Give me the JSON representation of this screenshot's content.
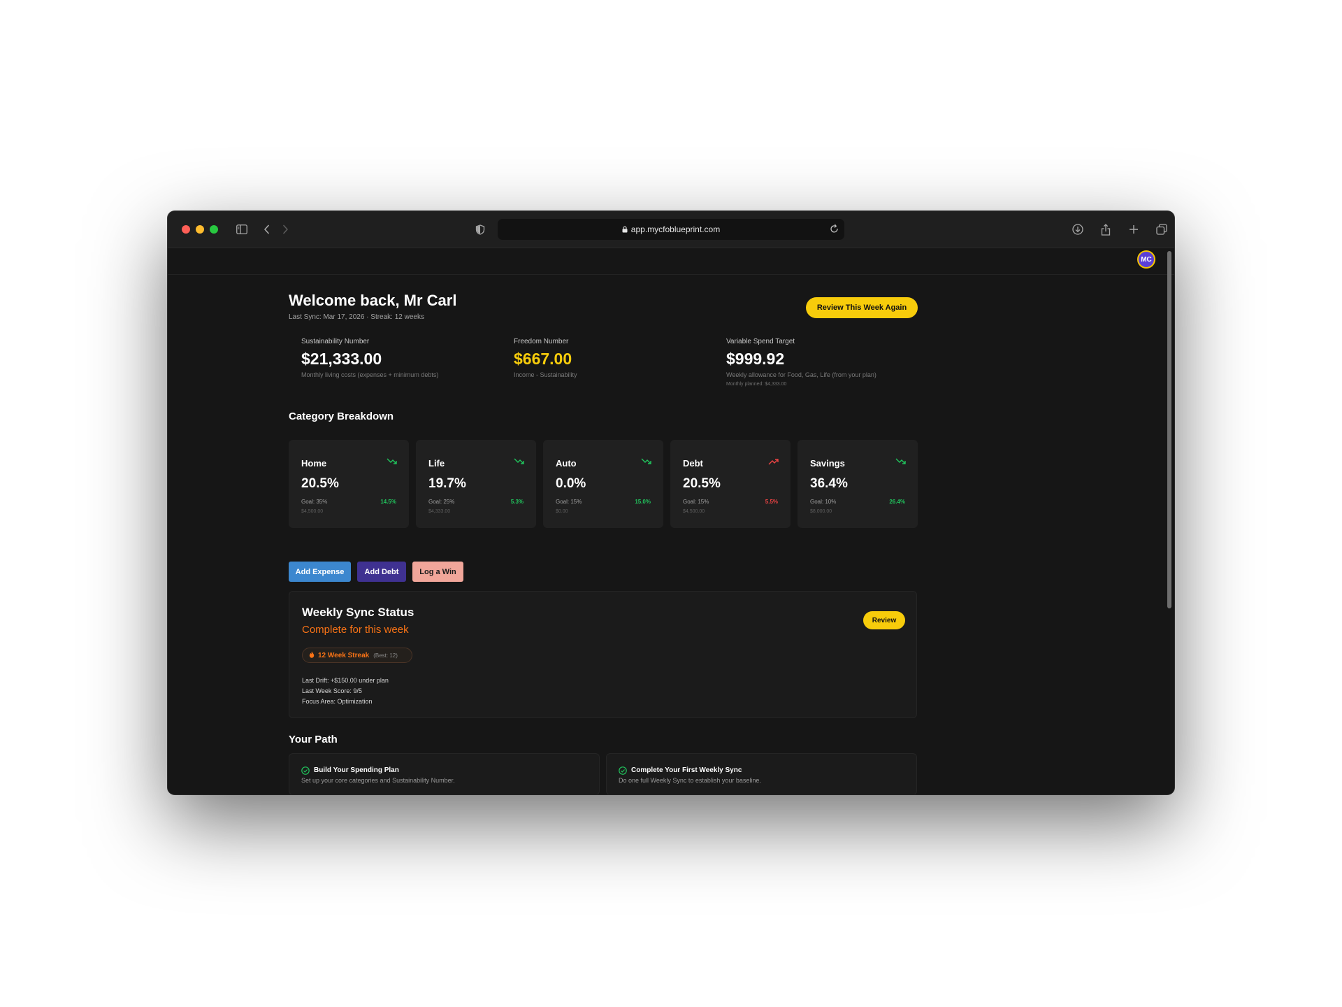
{
  "browser": {
    "url": "app.mycfoblueprint.com"
  },
  "user": {
    "initials": "MC"
  },
  "header": {
    "welcome": "Welcome back, Mr Carl",
    "subline": "Last Sync: Mar 17, 2026 · Streak: 12 weeks",
    "review_week_label": "Review This Week Again"
  },
  "metrics": [
    {
      "label": "Sustainability Number",
      "value": "$21,333.00",
      "description": "Monthly living costs (expenses + minimum debts)",
      "sub": ""
    },
    {
      "label": "Freedom Number",
      "value": "$667.00",
      "description": "Income - Sustainability",
      "sub": ""
    },
    {
      "label": "Variable Spend Target",
      "value": "$999.92",
      "description": "Weekly allowance for Food, Gas, Life (from your plan)",
      "sub": "Monthly planned: $4,333.00"
    }
  ],
  "category_title": "Category Breakdown",
  "categories": [
    {
      "name": "Home",
      "percent": "20.5%",
      "goal": "Goal: 35%",
      "diff": "14.5%",
      "amount": "$4,500.00",
      "trend": "down"
    },
    {
      "name": "Life",
      "percent": "19.7%",
      "goal": "Goal: 25%",
      "diff": "5.3%",
      "amount": "$4,333.00",
      "trend": "down"
    },
    {
      "name": "Auto",
      "percent": "0.0%",
      "goal": "Goal: 15%",
      "diff": "15.0%",
      "amount": "$0.00",
      "trend": "down"
    },
    {
      "name": "Debt",
      "percent": "20.5%",
      "goal": "Goal: 15%",
      "diff": "5.5%",
      "amount": "$4,500.00",
      "trend": "up"
    },
    {
      "name": "Savings",
      "percent": "36.4%",
      "goal": "Goal: 10%",
      "diff": "26.4%",
      "amount": "$8,000.00",
      "trend": "down"
    }
  ],
  "actions": {
    "add_expense": "Add Expense",
    "add_debt": "Add Debt",
    "log_win": "Log a Win"
  },
  "weekly_sync": {
    "title": "Weekly Sync Status",
    "status": "Complete for this week",
    "streak": "12 Week Streak",
    "best": "(Best: 12)",
    "last_drift": "Last Drift: +$150.00 under plan",
    "last_score": "Last Week Score: 9/5",
    "focus": "Focus Area: Optimization",
    "review_label": "Review"
  },
  "path": {
    "title": "Your Path",
    "items": [
      {
        "title": "Build Your Spending Plan",
        "description": "Set up your core categories and Sustainability Number."
      },
      {
        "title": "Complete Your First Weekly Sync",
        "description": "Do one full Weekly Sync to establish your baseline."
      }
    ]
  },
  "colors": {
    "accent": "#f7cc0b",
    "positive": "#21c45d",
    "negative": "#ef4444",
    "status": "#f97316",
    "add_expense": "#3c87cf",
    "add_debt": "#3f3191",
    "log_win": "#f1a69a"
  },
  "icons": [
    "sidebar-toggle-icon",
    "back-icon",
    "forward-icon",
    "shield-icon",
    "lock-icon",
    "reload-icon",
    "download-icon",
    "share-icon",
    "new-tab-icon",
    "tabs-overview-icon",
    "trend-icon",
    "flame-icon",
    "check-circle-icon"
  ]
}
